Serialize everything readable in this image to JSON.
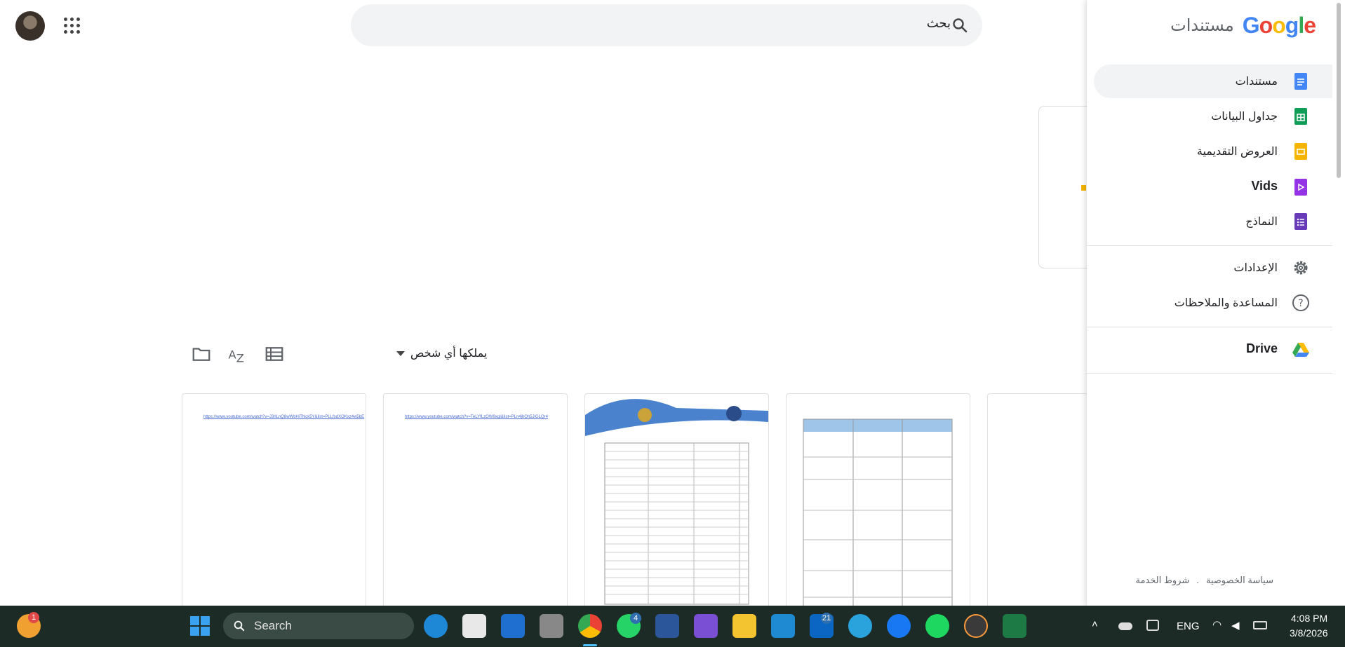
{
  "search": {
    "placeholder": "بحث"
  },
  "sidebar": {
    "brand_google": "Google",
    "brand_product": "مستندات",
    "items": [
      {
        "label": "مستندات",
        "icon": "docs-icon",
        "color": "#4285f4"
      },
      {
        "label": "جداول البيانات",
        "icon": "sheets-icon",
        "color": "#0f9d58"
      },
      {
        "label": "العروض التقديمية",
        "icon": "slides-icon",
        "color": "#f4b400"
      },
      {
        "label": "Vids",
        "icon": "vids-icon",
        "color": "#9334e6"
      },
      {
        "label": "النماذج",
        "icon": "forms-icon",
        "color": "#673ab7"
      }
    ],
    "settings": "الإعدادات",
    "help": "المساعدة والملاحظات",
    "drive": "Drive",
    "footer": {
      "privacy": "سياسة الخصوصية",
      "terms": "شروط الخدمة",
      "separator": "."
    }
  },
  "toolbar": {
    "owner_filter": "يملكها أي شخص"
  },
  "documents": [
    {
      "link_text": "https://www.youtube.com/watch?v=J3rlLnQ8wWbHiTNck5Y&list=PLLfsdXOKxz4w5bE"
    },
    {
      "link_text": "https://www.youtube.com/watch?v=TeLYfLzOW9xgI&list=PLn4jhQh5JiGLQr4"
    },
    {
      "link_text": ""
    },
    {
      "link_text": ""
    }
  ],
  "taskbar": {
    "search_label": "Search",
    "weather_badge": "1",
    "whatsapp_badge": "4",
    "linkedin_badge": "21",
    "lang": "ENG",
    "time": "4:08 PM",
    "date": "3/8/2026"
  }
}
